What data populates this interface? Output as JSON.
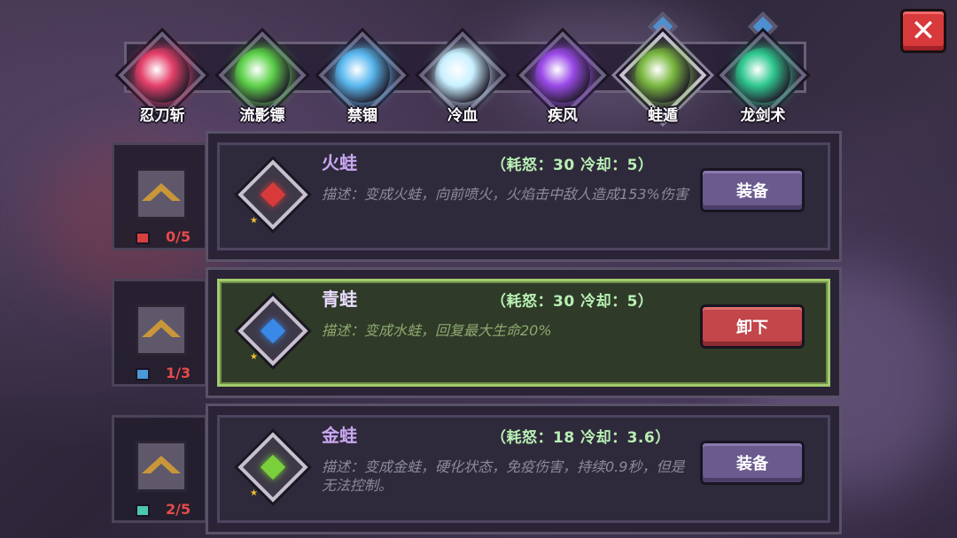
{
  "close": {
    "label": "✕"
  },
  "skills": [
    {
      "name": "忍刀斩",
      "icon": "red-slash-orb-icon",
      "color": "#e4406a",
      "active": false,
      "gem": false
    },
    {
      "name": "流影镖",
      "icon": "green-shuriken-swirl-icon",
      "color": "#5ed24a",
      "active": false,
      "gem": false
    },
    {
      "name": "禁锢",
      "icon": "blue-ice-orb-icon",
      "color": "#5ab8f0",
      "active": false,
      "gem": false
    },
    {
      "name": "冷血",
      "icon": "ice-crystal-icon",
      "color": "#c8f0ff",
      "active": false,
      "gem": false
    },
    {
      "name": "疾风",
      "icon": "purple-flame-icon",
      "color": "#9a4ae8",
      "active": false,
      "gem": false
    },
    {
      "name": "蛙遁",
      "icon": "frog-icon",
      "color": "#7ab840",
      "active": true,
      "gem": true
    },
    {
      "name": "龙剑术",
      "icon": "green-swords-icon",
      "color": "#30c890",
      "active": false,
      "gem": true
    }
  ],
  "cards": [
    {
      "level_text": "0/5",
      "level_color": "#e84a4a",
      "level_icon_color": "#d84040",
      "gem_icon": "red-gem-icon",
      "gem_color": "#d83a3a",
      "title": "火蛙",
      "stats": "（耗怒：30  冷却：5）",
      "desc": "描述：变成火蛙，向前喷火，火焰击中敌人造成153%伤害",
      "button": "装备",
      "equipped": false
    },
    {
      "level_text": "1/3",
      "level_color": "#e84a4a",
      "level_icon_color": "#4a9ad8",
      "gem_icon": "blue-water-gem-icon",
      "gem_color": "#3a88e8",
      "title": "青蛙",
      "stats": "（耗怒：30  冷却：5）",
      "desc": "描述：变成水蛙，回复最大生命20%",
      "button": "卸下",
      "equipped": true
    },
    {
      "level_text": "2/5",
      "level_color": "#e84a4a",
      "level_icon_color": "#4ac8b0",
      "gem_icon": "green-gem-icon",
      "gem_color": "#7ad03a",
      "title": "金蛙",
      "stats": "（耗怒：18  冷却：3.6）",
      "desc": "描述：变成金蛙，硬化状态，免疫伤害，持续0.9秒，但是无法控制。",
      "button": "装备",
      "equipped": false
    }
  ]
}
